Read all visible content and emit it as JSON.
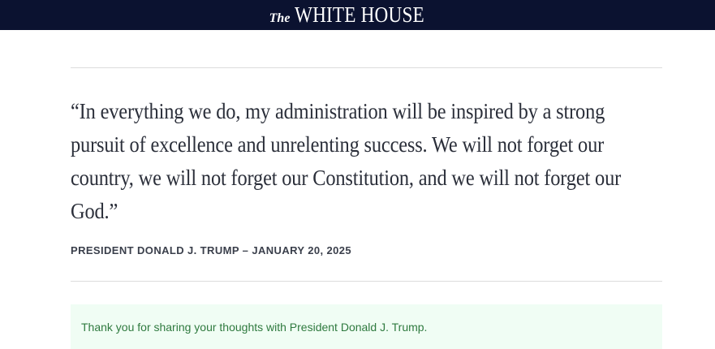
{
  "header": {
    "brand_prefix": "The",
    "brand_name": "WHITE HOUSE"
  },
  "quote": {
    "text": "“In everything we do, my administration will be inspired by a strong pursuit of excellence and unrelenting success.  We will not forget our country, we will not forget our Constitution, and we will not forget our God.”",
    "attribution": "PRESIDENT DONALD J. TRUMP – JANUARY 20, 2025"
  },
  "confirmation": {
    "message": "Thank you for sharing your thoughts with President Donald J. Trump."
  },
  "colors": {
    "header_bg": "#0b1230",
    "confirmation_bg": "#f0fdf4",
    "confirmation_text": "#2f7a3f"
  }
}
